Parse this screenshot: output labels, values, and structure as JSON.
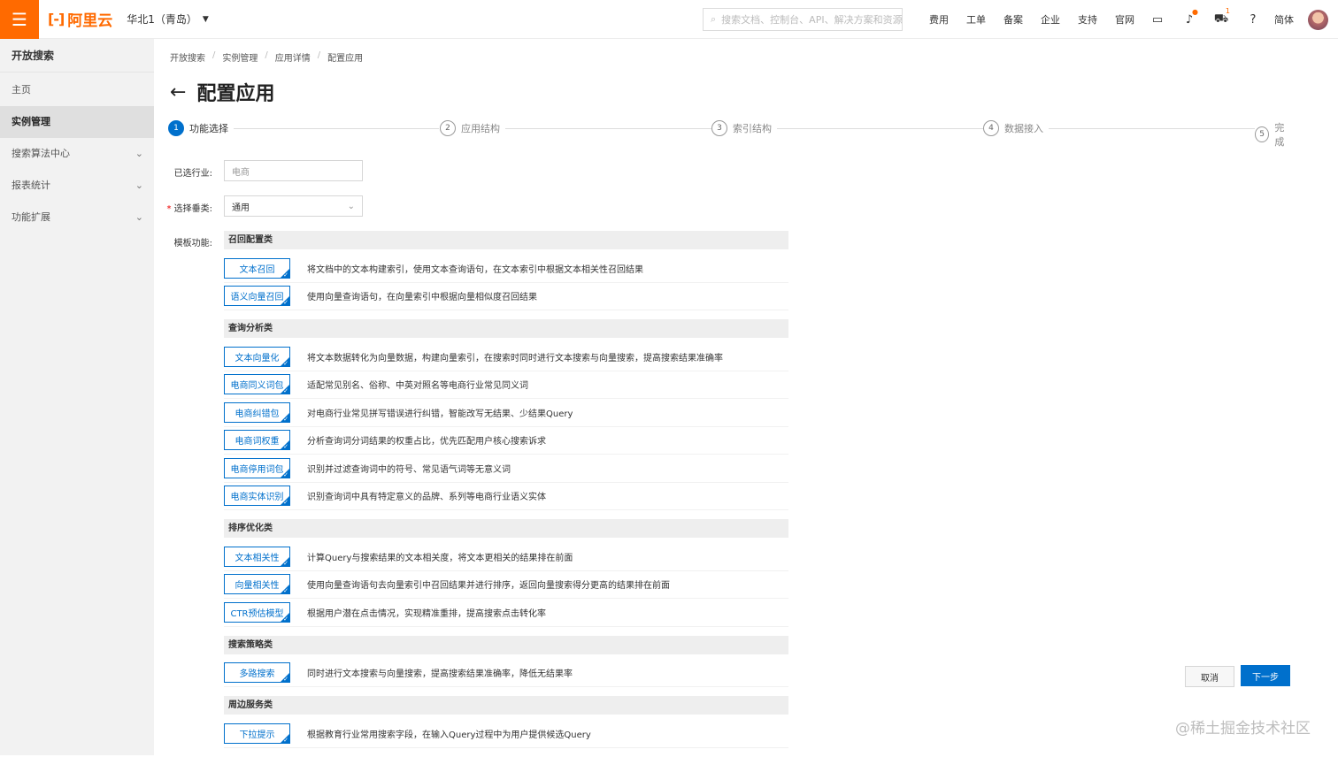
{
  "header": {
    "brand": "阿里云",
    "region": "华北1（青岛）",
    "search_placeholder": "搜索文档、控制台、API、解决方案和资源",
    "links": [
      "费用",
      "工单",
      "备案",
      "企业",
      "支持",
      "官网"
    ],
    "notification_count": "1",
    "lang": "简体",
    "accent": "#ff6a00"
  },
  "sidebar": {
    "title": "开放搜索",
    "items": [
      {
        "label": "主页"
      },
      {
        "label": "实例管理"
      },
      {
        "label": "搜索算法中心"
      },
      {
        "label": "报表统计"
      },
      {
        "label": "功能扩展"
      }
    ]
  },
  "breadcrumb": [
    "开放搜索",
    "实例管理",
    "应用详情",
    "配置应用"
  ],
  "page_title": "配置应用",
  "steps": [
    {
      "num": "1",
      "label": "功能选择"
    },
    {
      "num": "2",
      "label": "应用结构"
    },
    {
      "num": "3",
      "label": "索引结构"
    },
    {
      "num": "4",
      "label": "数据接入"
    },
    {
      "num": "5",
      "label": "完成"
    }
  ],
  "form": {
    "industry_label": "已选行业:",
    "industry_value": "电商",
    "category_label": "选择垂类:",
    "category_value": "通用",
    "template_label": "模板功能:"
  },
  "groups": [
    {
      "title": "召回配置类",
      "features": [
        {
          "tag": "文本召回",
          "desc": "将文档中的文本构建索引，使用文本查询语句，在文本索引中根据文本相关性召回结果"
        },
        {
          "tag": "语义向量召回",
          "desc": "使用向量查询语句，在向量索引中根据向量相似度召回结果"
        }
      ]
    },
    {
      "title": "查询分析类",
      "features": [
        {
          "tag": "文本向量化",
          "desc": "将文本数据转化为向量数据，构建向量索引，在搜索时同时进行文本搜索与向量搜索，提高搜索结果准确率"
        },
        {
          "tag": "电商同义词包",
          "desc": "适配常见别名、俗称、中英对照名等电商行业常见同义词"
        },
        {
          "tag": "电商纠错包",
          "desc": "对电商行业常见拼写错误进行纠错，智能改写无结果、少结果Query"
        },
        {
          "tag": "电商词权重",
          "desc": "分析查询词分词结果的权重占比，优先匹配用户核心搜索诉求"
        },
        {
          "tag": "电商停用词包",
          "desc": "识别并过滤查询词中的符号、常见语气词等无意义词"
        },
        {
          "tag": "电商实体识别",
          "desc": "识别查询词中具有特定意义的品牌、系列等电商行业语义实体"
        }
      ]
    },
    {
      "title": "排序优化类",
      "features": [
        {
          "tag": "文本相关性",
          "desc": "计算Query与搜索结果的文本相关度，将文本更相关的结果排在前面"
        },
        {
          "tag": "向量相关性",
          "desc": "使用向量查询语句去向量索引中召回结果并进行排序，返回向量搜索得分更高的结果排在前面"
        },
        {
          "tag": "CTR预估模型",
          "desc": "根据用户潜在点击情况，实现精准重排，提高搜索点击转化率"
        }
      ]
    },
    {
      "title": "搜索策略类",
      "features": [
        {
          "tag": "多路搜索",
          "desc": "同时进行文本搜索与向量搜索，提高搜索结果准确率，降低无结果率"
        }
      ]
    },
    {
      "title": "周边服务类",
      "features": [
        {
          "tag": "下拉提示",
          "desc": "根据教育行业常用搜索字段，在输入Query过程中为用户提供候选Query"
        }
      ]
    }
  ],
  "buttons": {
    "cancel": "取消",
    "next": "下一步"
  },
  "watermark": "@稀土掘金技术社区"
}
